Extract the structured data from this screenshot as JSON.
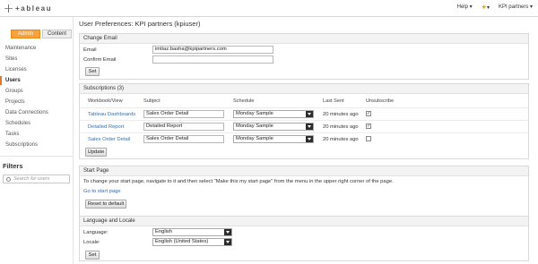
{
  "app": {
    "logo_text": "+ableau"
  },
  "topmenu": {
    "help": "Help ▾",
    "favorites": "▾",
    "user": "KPI partners ▾"
  },
  "sidebar": {
    "tabs": [
      {
        "label": "Admin"
      },
      {
        "label": "Content"
      }
    ],
    "items": [
      {
        "label": "Maintenance"
      },
      {
        "label": "Sites"
      },
      {
        "label": "Licenses"
      },
      {
        "label": "Users"
      },
      {
        "label": "Groups"
      },
      {
        "label": "Projects"
      },
      {
        "label": "Data Connections"
      },
      {
        "label": "Schedules"
      },
      {
        "label": "Tasks"
      },
      {
        "label": "Subscriptions"
      }
    ],
    "filters_heading": "Filters",
    "search_placeholder": "Search for users"
  },
  "main": {
    "title": "User Preferences: KPI partners (kpiuser)",
    "change_email": {
      "heading": "Change Email",
      "email_label": "Email",
      "email_value": "imtiaz.basha@kpipartners.com",
      "confirm_label": "Confirm Email",
      "confirm_value": "",
      "set_label": "Set"
    },
    "subscriptions": {
      "heading": "Subscriptions (3)",
      "columns": [
        "Workbook/View",
        "Subject",
        "Schedule",
        "Last Sent",
        "Unsubscribe"
      ],
      "rows": [
        {
          "view": "Tableau Dashboards",
          "subject": "Sales Order Detail",
          "schedule": "Monday Sample",
          "last_sent": "20 minutes ago",
          "checked": true
        },
        {
          "view": "Detailed Report",
          "subject": "Detailed Report",
          "schedule": "Monday Sample",
          "last_sent": "20 minutes ago",
          "checked": true
        },
        {
          "view": "Sales Order Detail",
          "subject": "Sales Order Detail",
          "schedule": "Monday Sample",
          "last_sent": "20 minutes ago",
          "checked": false
        }
      ],
      "update_label": "Update"
    },
    "start_page": {
      "heading": "Start Page",
      "description": "To change your start page, navigate to it and then select \"Make this my start page\" from the menu in the upper right corner of the page.",
      "link_label": "Go to start page",
      "reset_label": "Reset to default"
    },
    "language": {
      "heading": "Language and Locale",
      "language_label": "Language:",
      "language_value": "English",
      "locale_label": "Locale:",
      "locale_value": "English (United States)",
      "set_label": "Set"
    }
  }
}
